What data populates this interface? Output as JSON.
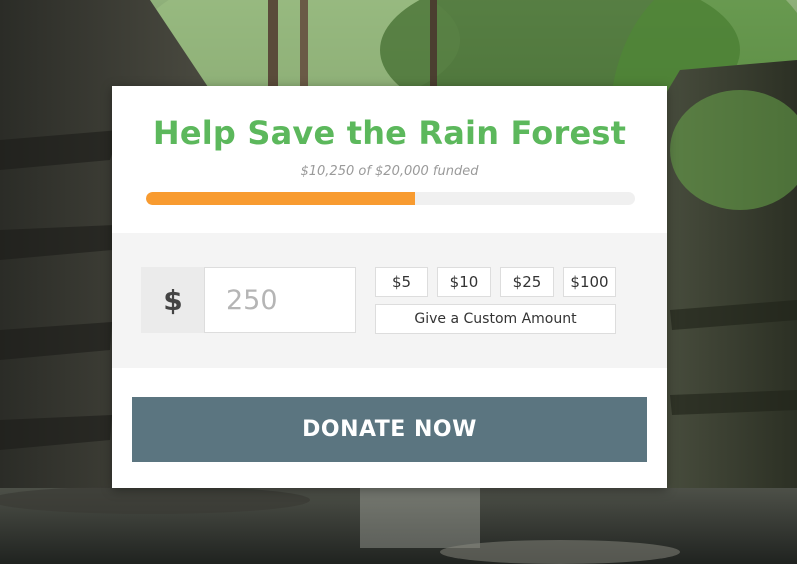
{
  "campaign": {
    "title": "Help Save the Rain Forest",
    "funded_text": "$10,250 of $20,000 funded",
    "progress_fraction": 0.55,
    "progress_color": "#f89b30",
    "title_color": "#5cb85c"
  },
  "donation": {
    "currency_symbol": "$",
    "amount_placeholder": "250",
    "presets": [
      "$5",
      "$10",
      "$25",
      "$100"
    ],
    "custom_label": "Give a Custom Amount"
  },
  "donate_button": {
    "label": "DONATE NOW",
    "color": "#5b7580"
  }
}
